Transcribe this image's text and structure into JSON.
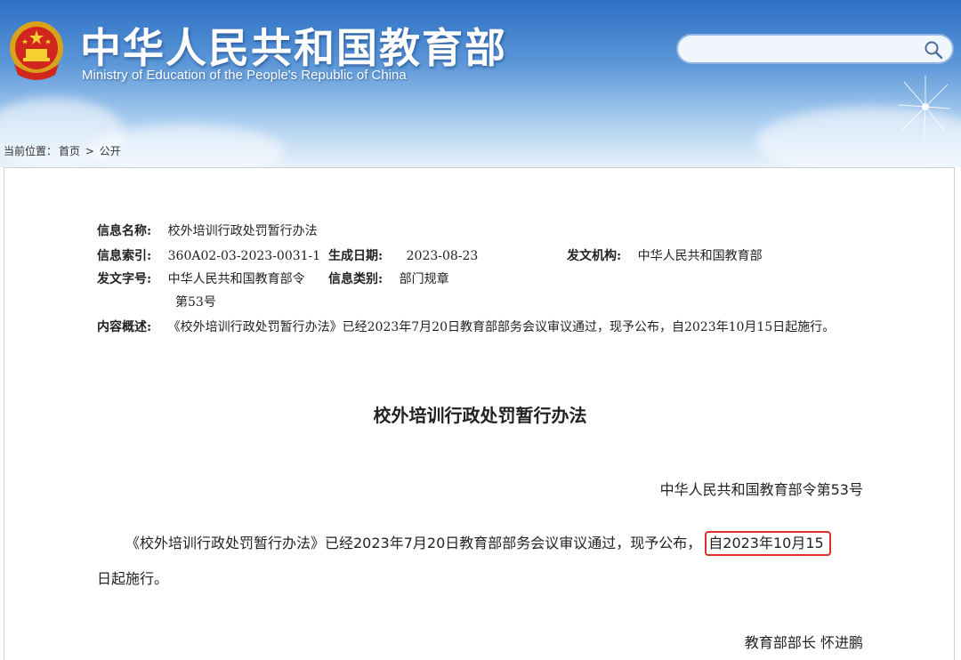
{
  "header": {
    "title": "中华人民共和国教育部",
    "subtitle": "Ministry of Education of the People's Republic of China",
    "search_placeholder": ""
  },
  "breadcrumb": {
    "label": "当前位置：",
    "home": "首页",
    "separator": ">",
    "current": "公开"
  },
  "meta": {
    "name_label": "信息名称:",
    "name_value": "校外培训行政处罚暂行办法",
    "index_label": "信息索引:",
    "index_value": "360A02-03-2023-0031-1",
    "date_label": "生成日期:",
    "date_value": "2023-08-23",
    "issuer_label": "发文机构:",
    "issuer_value": "中华人民共和国教育部",
    "docno_label": "发文字号:",
    "docno_value_line1": "中华人民共和国教育部令",
    "docno_value_line2": "第53号",
    "category_label": "信息类别:",
    "category_value": "部门规章",
    "summary_label": "内容概述:",
    "summary_value": "《校外培训行政处罚暂行办法》已经2023年7月20日教育部部务会议审议通过，现予公布，自2023年10月15日起施行。"
  },
  "document": {
    "title": "校外培训行政处罚暂行办法",
    "decree_no": "中华人民共和国教育部令第53号",
    "body_part1": "《校外培训行政处罚暂行办法》已经2023年7月20日教育部部务会议审议通过，现予公布，",
    "body_highlight": "自2023年10月15",
    "body_part2": "日起施行。",
    "signature": "教育部部长  怀进鹏"
  },
  "colors": {
    "header_top": "#2d6fc4",
    "highlight_border": "#d9322b"
  }
}
